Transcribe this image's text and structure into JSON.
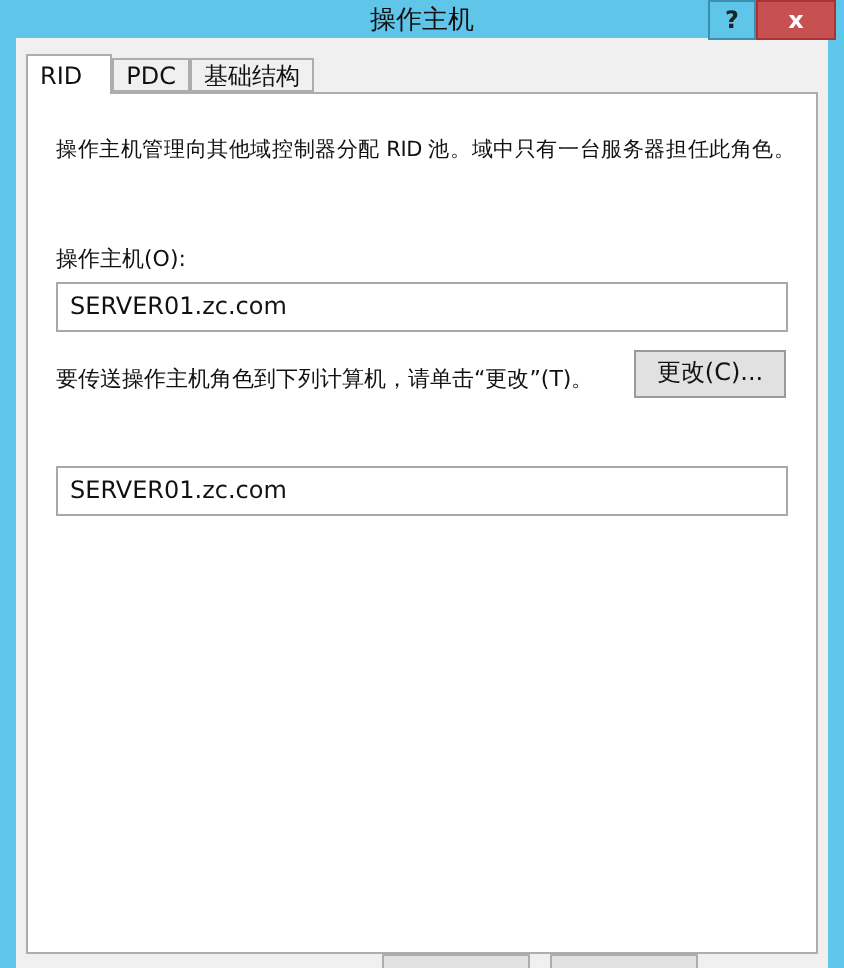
{
  "window": {
    "title": "操作主机",
    "buttons": [
      "?",
      "x"
    ]
  },
  "tabs": [
    {
      "label": "RID",
      "selected": true
    },
    {
      "label": "PDC",
      "selected": false
    },
    {
      "label": "基础结构",
      "selected": false
    }
  ],
  "description": "操作主机管理向其他域控制器分配 RID 池。域中只有一台服务器担任此角色。",
  "operations_master": {
    "label": "操作主机(O):",
    "value": "SERVER01.zc.com"
  },
  "transfer": {
    "text": "要传送操作主机角色到下列计算机，请单击“更改”(T)。",
    "button": "更改(C)...",
    "value": "SERVER01.zc.com"
  }
}
